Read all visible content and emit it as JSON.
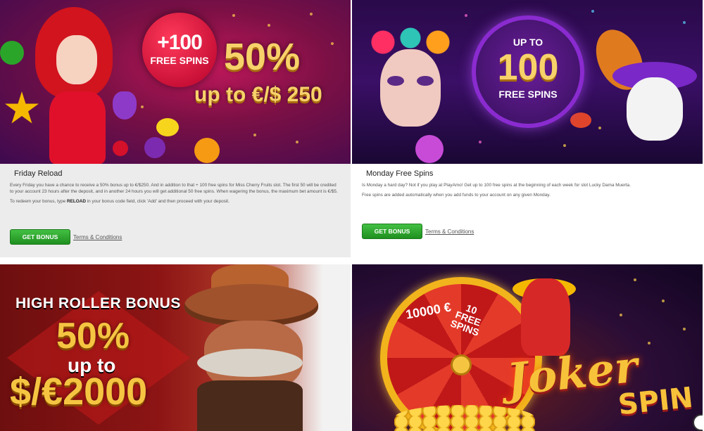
{
  "promos": {
    "friday": {
      "banner": {
        "badge_big": "+100",
        "badge_small": "FREE SPINS",
        "headline": "50%",
        "subline": "up to €/$ 250"
      },
      "title": "Friday Reload",
      "paragraph_1": "Every Friday you have a chance to receive a 50% bonus up to €/$250. And in addition to that + 100 free spins for Miss Cherry Fruits slot. The first 50 will be credited to your account 23 hours after the deposit, and in another 24 hours you will get additional 50 free spins. When wagering the bonus, the maximum bet amount is €/$5.",
      "paragraph_2_before": "To redeem your bonus, type ",
      "paragraph_2_code": "RELOAD",
      "paragraph_2_after": " in your bonus code field, click 'Add' and then proceed with your deposit.",
      "button_label": "GET BONUS",
      "terms_label": "Terms & Conditions"
    },
    "monday": {
      "banner": {
        "upto": "UP TO",
        "number": "100",
        "label": "FREE SPINS"
      },
      "title": "Monday Free Spins",
      "paragraph_1": "Is Monday a hard day? Not if you play at PlayAmo! Get up to 100 free spins at the beginning of each week for slot Lucky Dama Muerta.",
      "paragraph_2": "Free spins are added automatically when you add funds to your account on any given Monday.",
      "button_label": "GET BONUS",
      "terms_label": "Terms & Conditions"
    },
    "high_roller": {
      "title": "HIGH ROLLER BONUS",
      "percent": "50%",
      "upto": "up to",
      "amount": "$/€2000"
    },
    "joker": {
      "word_1": "Joker",
      "word_2": "SPIN",
      "wheel_value": "10000",
      "wheel_currency": "€",
      "wheel_segment": "10 FREE SPINS"
    }
  },
  "colors": {
    "button_green": "#2aa52a",
    "gold_text": "#f7d26a",
    "card_gray": "#ececec"
  }
}
